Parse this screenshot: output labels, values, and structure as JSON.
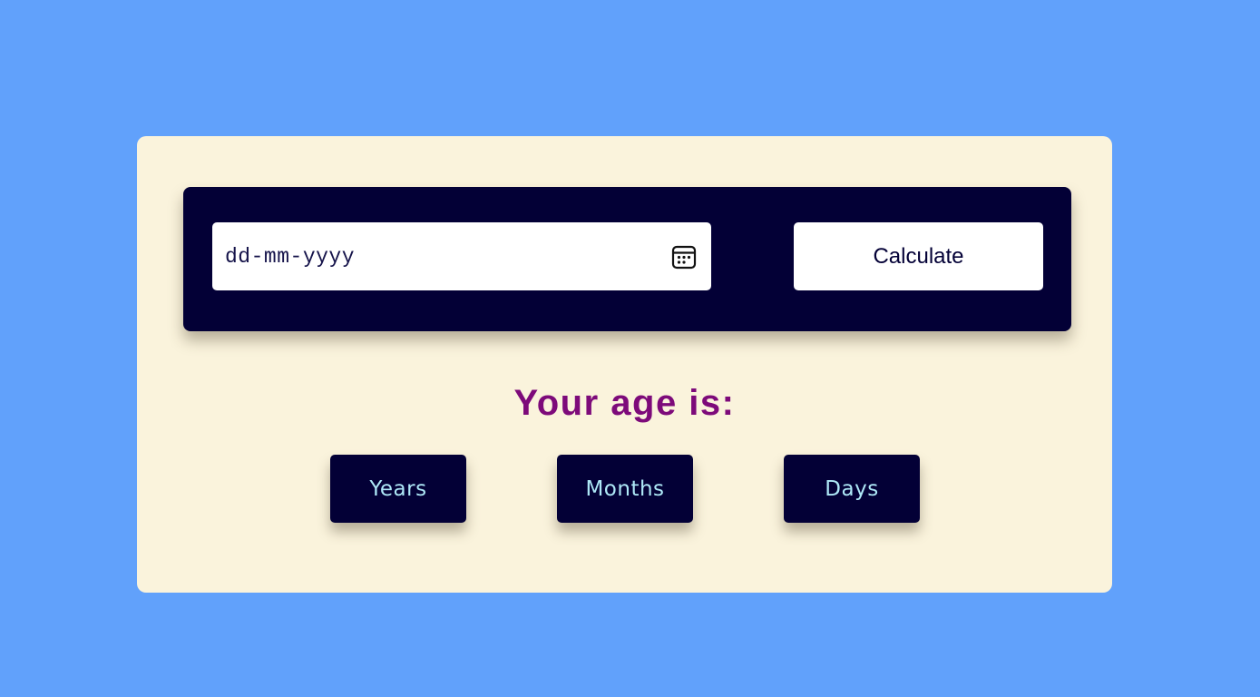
{
  "form": {
    "date_placeholder": "dd-mm-yyyy",
    "calendar_icon": "calendar-icon",
    "calculate_label": "Calculate"
  },
  "result": {
    "title": "Your age is:",
    "years_label": "Years",
    "months_label": "Months",
    "days_label": "Days"
  },
  "colors": {
    "page_background": "#61a1fb",
    "card_background": "#faf3dc",
    "panel_background": "#030036",
    "title_color": "#7d0a7a",
    "box_text_color": "#aee8f7"
  }
}
